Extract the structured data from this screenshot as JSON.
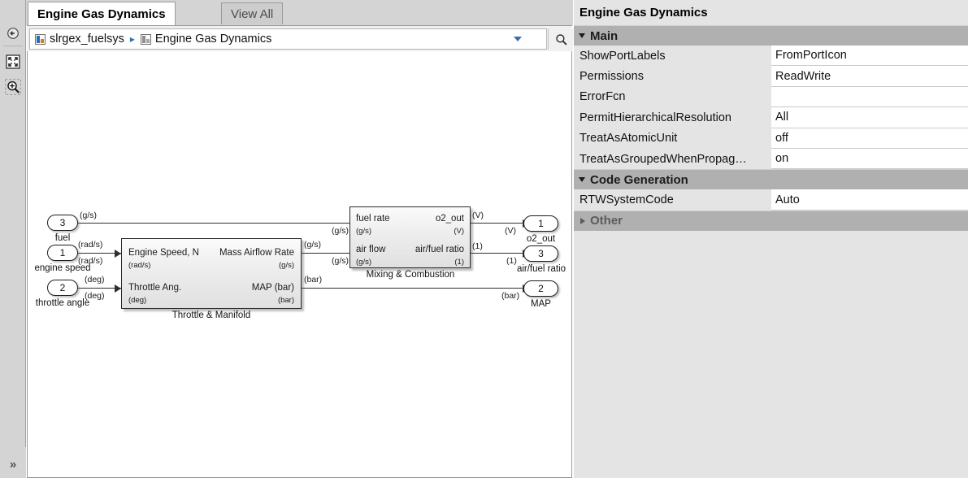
{
  "left_toolbar": {
    "buttons": [
      {
        "name": "back-to-parent",
        "icon": "arrow-left-circle-icon"
      },
      {
        "name": "fit-to-view",
        "icon": "fit-to-view-icon"
      },
      {
        "name": "zoom-in",
        "icon": "zoom-in-icon"
      }
    ],
    "expand_label": "»"
  },
  "tabs": [
    {
      "label": "Engine Gas Dynamics",
      "active": true
    },
    {
      "label": "View All",
      "active": false
    }
  ],
  "breadcrumb": {
    "items": [
      {
        "label": "slrgex_fuelsys",
        "icon": "model-icon"
      },
      {
        "label": "Engine Gas Dynamics",
        "icon": "subsystem-icon"
      }
    ],
    "separator": "▸",
    "dropdown_icon": "chevron-down-icon",
    "search_icon": "search-icon"
  },
  "diagram": {
    "inports": [
      {
        "number": "3",
        "label": "fuel",
        "unit": "(g/s)"
      },
      {
        "number": "1",
        "label": "engine speed",
        "unit": "(rad/s)"
      },
      {
        "number": "2",
        "label": "throttle angle",
        "unit": "(deg)"
      }
    ],
    "outports": [
      {
        "number": "1",
        "label": "o2_out",
        "unit": "(V)"
      },
      {
        "number": "3",
        "label": "air/fuel ratio",
        "unit": "(1)"
      },
      {
        "number": "2",
        "label": "MAP",
        "unit": "(bar)"
      }
    ],
    "blocks": [
      {
        "name": "Throttle & Manifold",
        "inputs": [
          {
            "name": "Engine Speed, N",
            "unit": "(rad/s)"
          },
          {
            "name": "Throttle Ang.",
            "unit": "(deg)"
          }
        ],
        "outputs": [
          {
            "name": "Mass Airflow Rate",
            "unit": "(g/s)"
          },
          {
            "name": "MAP (bar)",
            "unit": "(bar)"
          }
        ]
      },
      {
        "name": "Mixing & Combustion",
        "inputs": [
          {
            "name": "fuel rate",
            "unit": "(g/s)"
          },
          {
            "name": "air flow",
            "unit": "(g/s)"
          }
        ],
        "outputs": [
          {
            "name": "o2_out",
            "unit": "(V)"
          },
          {
            "name": "air/fuel ratio",
            "unit": "(1)"
          }
        ]
      }
    ],
    "signal_labels": {
      "fuel_src": "(g/s)",
      "fuel_dst": "(g/s)",
      "speed_src": "(rad/s)",
      "speed_dst": "(rad/s)",
      "throttle_src": "(deg)",
      "throttle_dst": "(deg)",
      "airflow_src": "(g/s)",
      "airflow_dst": "(g/s)",
      "map_src": "(bar)",
      "map_dst": "(bar)",
      "o2_src": "(V)",
      "o2_dst": "(V)",
      "afr_src": "(1)",
      "afr_dst": "(1)"
    }
  },
  "properties": {
    "title": "Engine Gas Dynamics",
    "sections": [
      {
        "name": "Main",
        "expanded": true,
        "rows": [
          {
            "key": "ShowPortLabels",
            "value": "FromPortIcon"
          },
          {
            "key": "Permissions",
            "value": "ReadWrite"
          },
          {
            "key": "ErrorFcn",
            "value": ""
          },
          {
            "key": "PermitHierarchicalResolution",
            "value": "All"
          },
          {
            "key": "TreatAsAtomicUnit",
            "value": "off"
          },
          {
            "key": "TreatAsGroupedWhenPropag…",
            "value": "on"
          }
        ]
      },
      {
        "name": "Code Generation",
        "expanded": true,
        "rows": [
          {
            "key": "RTWSystemCode",
            "value": "Auto"
          }
        ]
      },
      {
        "name": "Other",
        "expanded": false,
        "rows": []
      }
    ]
  }
}
